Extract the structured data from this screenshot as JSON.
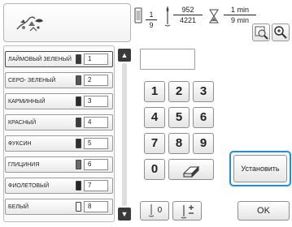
{
  "status": {
    "color_current": "1",
    "color_total": "9",
    "stitch_current": "952",
    "stitch_total": "4221",
    "time_current": "1",
    "time_total": "9",
    "time_unit": "min"
  },
  "color_list": [
    {
      "name": "ЛАЙМОВЫЙ ЗЕЛЕНЫЙ",
      "number": "1",
      "swatch": "#3a3a3a"
    },
    {
      "name": "СЕРО- ЗЕЛЕНЫЙ",
      "number": "2",
      "swatch": "#555555"
    },
    {
      "name": "КАРМИННЫЙ",
      "number": "3",
      "swatch": "#2b2b2b"
    },
    {
      "name": "КРАСНЫЙ",
      "number": "4",
      "swatch": "#3c3c3c"
    },
    {
      "name": "ФУКСИН",
      "number": "5",
      "swatch": "#2f2f2f"
    },
    {
      "name": "ГЛИЦИНИЯ",
      "number": "6",
      "swatch": "#6a6a6a"
    },
    {
      "name": "ФИОЛЕТОВЫЙ",
      "number": "7",
      "swatch": "#262626"
    },
    {
      "name": "БЕЛЫЙ",
      "number": "8",
      "swatch": "#f4f4f4"
    }
  ],
  "number_field": {
    "value": ""
  },
  "keypad": {
    "keys": [
      "1",
      "2",
      "3",
      "4",
      "5",
      "6",
      "7",
      "8",
      "9",
      "0"
    ]
  },
  "set_button": {
    "label": "Установить"
  },
  "bottom": {
    "needle_zero_label": "0",
    "ok_label": "OK"
  },
  "icons": {
    "scroll_up": "triangle-up",
    "scroll_down": "triangle-down",
    "spool": "thread-spool-icon",
    "needle": "needle-icon",
    "hourglass": "hourglass-icon",
    "zoom": "zoom-icon",
    "magnifier": "magnifier-icon",
    "eraser": "eraser-icon",
    "needle_plusminus": "needle-plus-minus-icon"
  },
  "colors": {
    "highlight": "#1e90d8",
    "scroll_button": "#3a3a3a"
  }
}
